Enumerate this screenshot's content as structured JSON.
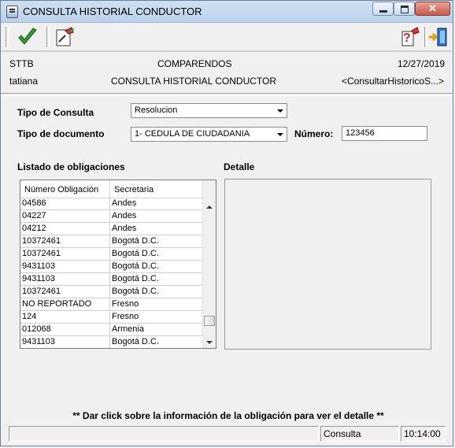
{
  "window": {
    "title": "CONSULTA HISTORIAL CONDUCTOR",
    "close_label": "✕"
  },
  "toolbar": {
    "accept_icon": "checkmark-icon",
    "report_icon": "document-pen-icon",
    "help_icon": "help-question-icon",
    "exit_icon": "exit-door-icon"
  },
  "header": {
    "system": "STTB",
    "module": "COMPARENDOS",
    "date": "12/27/2019",
    "user": "tatiana",
    "screen": "CONSULTA HISTORIAL CONDUCTOR",
    "form_id": "<ConsultarHistoricoS...>"
  },
  "form": {
    "tipo_consulta_label": "Tipo de Consulta",
    "tipo_consulta_value": "Resolucion",
    "tipo_documento_label": "Tipo de documento",
    "tipo_documento_value": "1- CEDULA DE CIUDADANIA",
    "numero_label": "Número:",
    "numero_value": "123456"
  },
  "obligations": {
    "title": "Listado de obligaciones",
    "columns": [
      "Número Obligación",
      "Secretaria"
    ],
    "rows": [
      [
        "04586",
        "Andes"
      ],
      [
        "04227",
        "Andes"
      ],
      [
        "04212",
        "Andes"
      ],
      [
        "10372461",
        "Bogotá D.C."
      ],
      [
        "10372461",
        "Bogotá D.C."
      ],
      [
        "9431103",
        "Bogotá D.C."
      ],
      [
        "9431103",
        "Bogotá D.C."
      ],
      [
        "10372461",
        "Bogotá D.C."
      ],
      [
        "NO REPORTADO",
        "Fresno"
      ],
      [
        "124",
        "Fresno"
      ],
      [
        "012068",
        "Armenia"
      ],
      [
        "9431103",
        "Bogotá D.C."
      ]
    ],
    "scroll_position": 0.92
  },
  "detail": {
    "title": "Detalle"
  },
  "footer": {
    "message": "** Dar click sobre la información de la obligación para ver el detalle **",
    "status_left": "",
    "status_mode": "Consulta",
    "status_time": "10:14:00"
  },
  "colors": {
    "accent_green": "#2e9b2e",
    "exit_blue": "#1f6fc0",
    "help_red": "#c0282d"
  }
}
